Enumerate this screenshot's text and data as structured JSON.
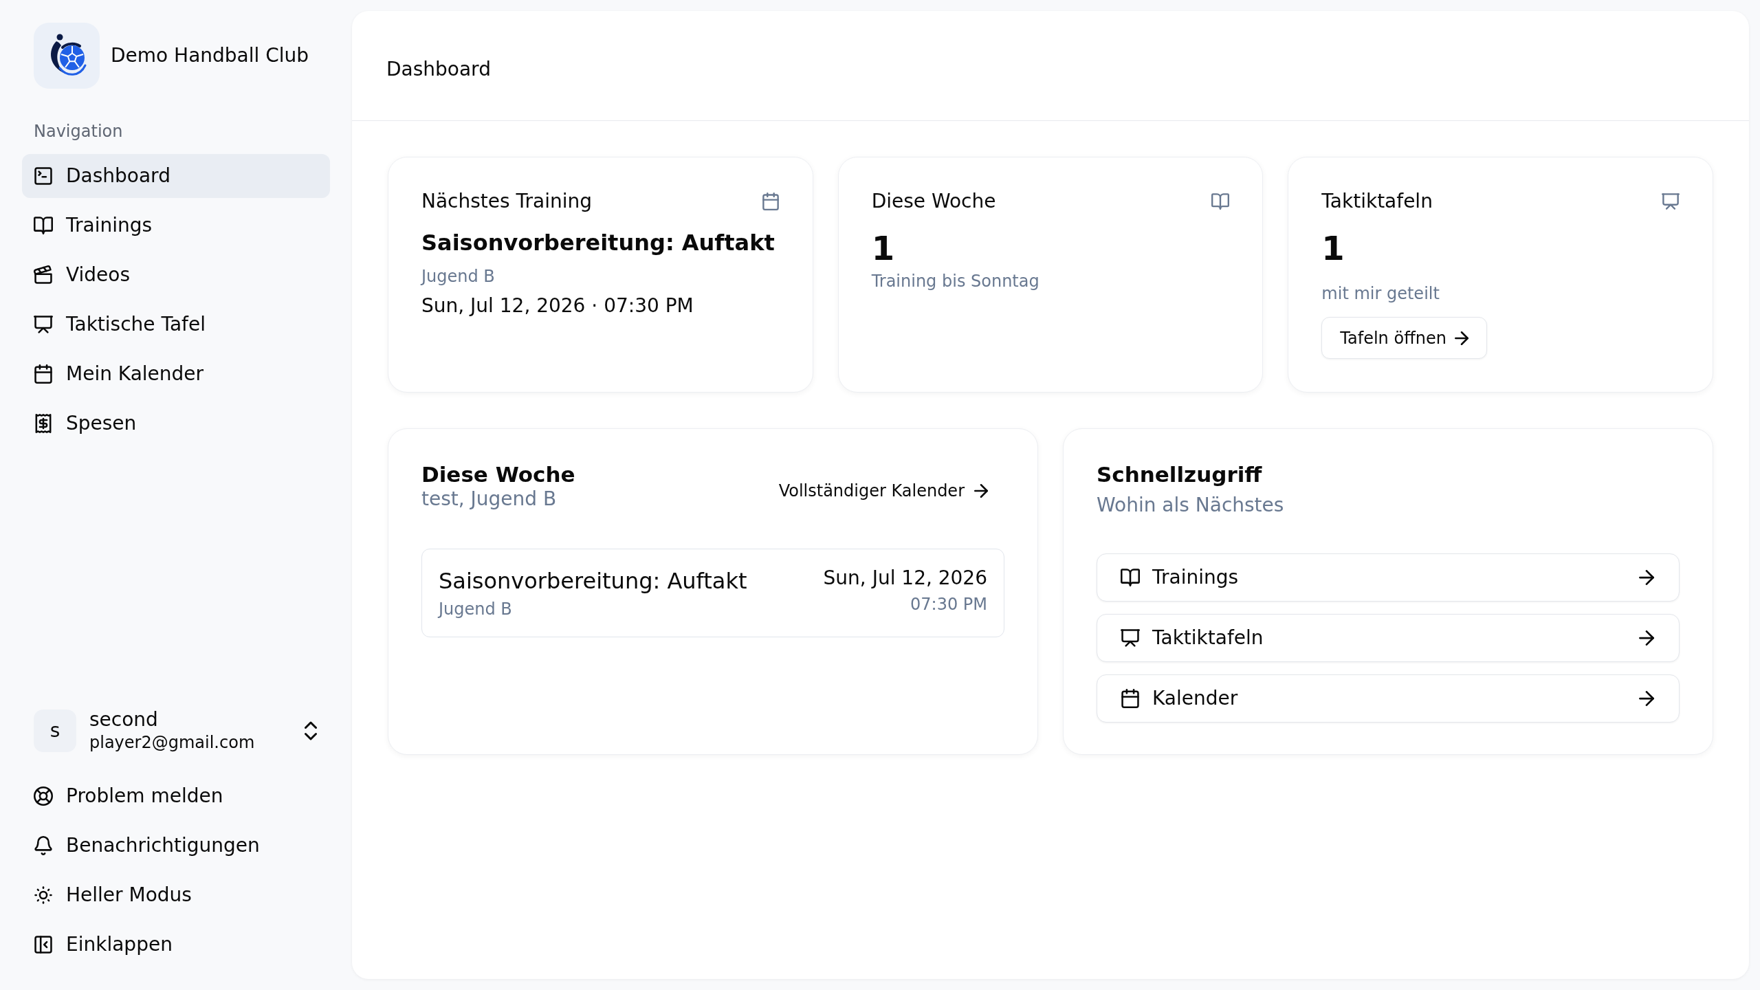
{
  "sidebar": {
    "club_name": "Demo Handball Club",
    "group_label": "Navigation",
    "nav_items": [
      {
        "label": "Dashboard",
        "selected": true
      },
      {
        "label": "Trainings",
        "selected": false
      },
      {
        "label": "Videos",
        "selected": false
      },
      {
        "label": "Taktische Tafel",
        "selected": false
      },
      {
        "label": "Mein Kalender",
        "selected": false
      },
      {
        "label": "Spesen",
        "selected": false
      }
    ],
    "user": {
      "initial": "s",
      "name": "second",
      "email": "player2@gmail.com"
    },
    "footer_items": [
      "Problem melden",
      "Benachrichtigungen",
      "Heller Modus",
      "Einklappen"
    ]
  },
  "header": {
    "title": "Dashboard"
  },
  "summary_cards": [
    {
      "kind": "event",
      "title": "Nächstes Training",
      "event_title": "Saisonvorbereitung: Auftakt",
      "team": "Jugend B",
      "when": "Sun, Jul 12, 2026 · 07:30 PM"
    },
    {
      "kind": "count",
      "title": "Diese Woche",
      "value": "1",
      "caption": "Training bis Sonntag"
    },
    {
      "kind": "count",
      "title": "Taktiktafeln",
      "value": "1",
      "caption": "mit mir geteilt",
      "button": "Tafeln öffnen"
    }
  ],
  "week_card": {
    "title": "Diese Woche",
    "subtitle": "test, Jugend B",
    "link": "Vollständiger Kalender",
    "events": [
      {
        "title": "Saisonvorbereitung: Auftakt",
        "team": "Jugend B",
        "date": "Sun, Jul 12, 2026",
        "time": "07:30 PM"
      }
    ]
  },
  "quick_access": {
    "title": "Schnellzugriff",
    "subtitle": "Wohin als Nächstes",
    "links": [
      "Trainings",
      "Taktiktafeln",
      "Kalender"
    ]
  }
}
